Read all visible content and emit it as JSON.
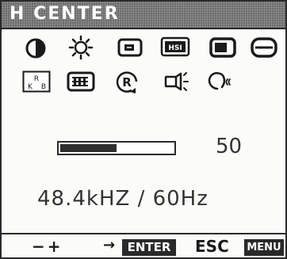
{
  "osd": {
    "title": "H CENTER",
    "icons": [
      "contrast-icon",
      "brightness-icon",
      "h-position-icon",
      "h-size-icon",
      "v-position-icon",
      "v-size-icon",
      "color-rgb-icon",
      "display-mode-icon",
      "recall-icon",
      "degauss-icon",
      "geometry-icon"
    ],
    "icon_labels": {
      "hsize": "HSI",
      "rgb_r": "R",
      "rgb_k": "K",
      "rgb_b": "B",
      "recall": "R"
    },
    "adjustment": {
      "value": "50",
      "level_fraction": 0.5
    },
    "frequency": "48.4kHZ  /  60Hz",
    "footer": {
      "adjust_label": "−+",
      "arrow": "→",
      "enter_key": "ENTER",
      "esc_label": "ESC",
      "menu_key": "MENU"
    }
  }
}
